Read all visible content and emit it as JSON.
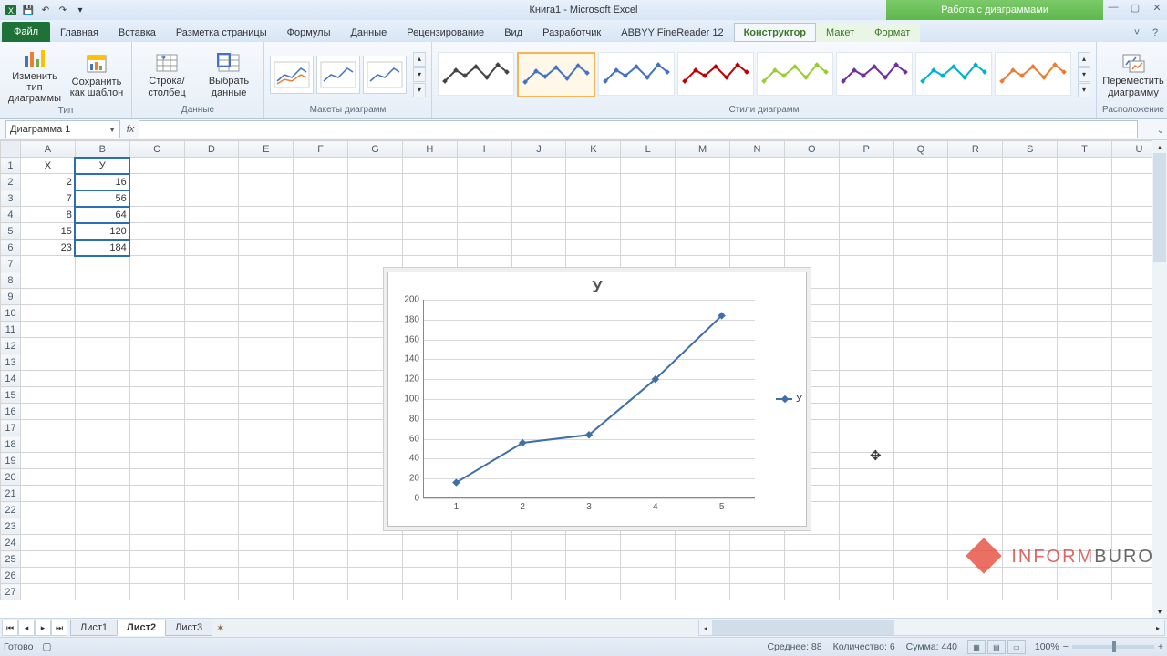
{
  "title": "Книга1 - Microsoft Excel",
  "contextual_tab_group": "Работа с диаграммами",
  "tabs": {
    "file": "Файл",
    "items": [
      "Главная",
      "Вставка",
      "Разметка страницы",
      "Формулы",
      "Данные",
      "Рецензирование",
      "Вид",
      "Разработчик",
      "ABBYY FineReader 12"
    ],
    "ctx": [
      "Конструктор",
      "Макет",
      "Формат"
    ],
    "active": "Конструктор"
  },
  "ribbon": {
    "type_group": {
      "label": "Тип",
      "change": "Изменить тип\nдиаграммы",
      "save": "Сохранить\nкак шаблон"
    },
    "data_group": {
      "label": "Данные",
      "switch": "Строка/столбец",
      "select": "Выбрать\nданные"
    },
    "layout_group": {
      "label": "Макеты диаграмм"
    },
    "styles_group": {
      "label": "Стили диаграмм"
    },
    "loc_group": {
      "label": "Расположение",
      "move": "Переместить\nдиаграмму"
    }
  },
  "namebox": "Диаграмма 1",
  "fx_label": "fx",
  "columns": [
    "A",
    "B",
    "C",
    "D",
    "E",
    "F",
    "G",
    "H",
    "I",
    "J",
    "K",
    "L",
    "M",
    "N",
    "O",
    "P",
    "Q",
    "R",
    "S",
    "T",
    "U"
  ],
  "rows": 27,
  "sheet": {
    "header": {
      "A": "Х",
      "B": "У"
    },
    "data": [
      {
        "A": 2,
        "B": 16
      },
      {
        "A": 7,
        "B": 56
      },
      {
        "A": 8,
        "B": 64
      },
      {
        "A": 15,
        "B": 120
      },
      {
        "A": 23,
        "B": 184
      }
    ]
  },
  "sheet_tabs": [
    "Лист1",
    "Лист2",
    "Лист3"
  ],
  "active_sheet": "Лист2",
  "status": {
    "ready": "Готово",
    "avg": "Среднее: 88",
    "count": "Количество: 6",
    "sum": "Сумма: 440",
    "zoom": "100%"
  },
  "watermark": {
    "t1": "INFORM",
    "t2": "BURO"
  },
  "chart_data": {
    "type": "line",
    "title": "У",
    "series": [
      {
        "name": "У",
        "values": [
          16,
          56,
          64,
          120,
          184
        ],
        "color": "#3f6fa8"
      }
    ],
    "categories": [
      1,
      2,
      3,
      4,
      5
    ],
    "ylim": [
      0,
      200
    ],
    "ystep": 20,
    "xlabel": "",
    "ylabel": ""
  },
  "style_colors": [
    "#444",
    "#4472c4",
    "#4472c4",
    "#c00000",
    "#9acd32",
    "#7030a0",
    "#00b0d0",
    "#ed7d31"
  ]
}
